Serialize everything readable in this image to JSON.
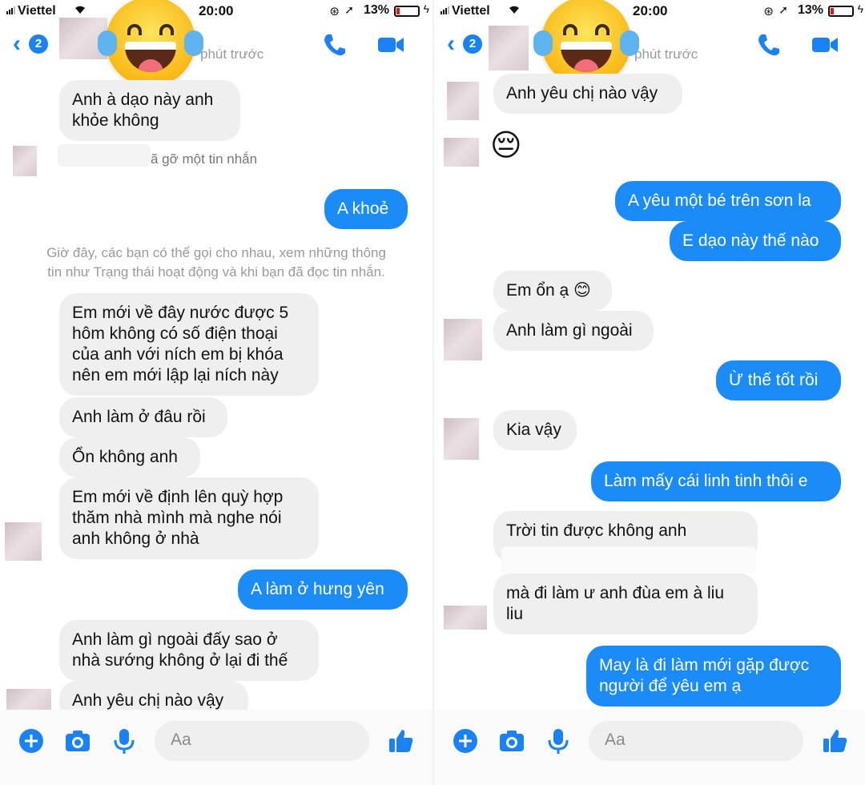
{
  "status_bar": {
    "carrier": "Viettel",
    "time": "20:00",
    "battery": "13%"
  },
  "left": {
    "header": {
      "back_count": "2",
      "active": "phút trước"
    },
    "messages": [
      {
        "dir": "in",
        "text": "Anh à dạo này anh\nkhỏe không"
      },
      {
        "dir": "removed",
        "text": "ã gỡ một tin nhắn"
      },
      {
        "dir": "out",
        "text": "A khoẻ"
      },
      {
        "dir": "notice",
        "text": "Giờ đây, các bạn có thể gọi cho nhau, xem những thông\ntin như Trạng thái hoạt động và khi bạn đã đọc tin nhắn."
      },
      {
        "dir": "in",
        "text": "Em mới về đây nước được 5\nhôm không có số điện thoại\ncủa anh với ních em bị khóa\nnên em mới lập lại ních này"
      },
      {
        "dir": "in",
        "text": "Anh làm ở đâu rồi"
      },
      {
        "dir": "in",
        "text": "Ổn không anh"
      },
      {
        "dir": "in",
        "text": "Em mới về định lên quỳ hợp\nthăm nhà mình mà nghe nói\nanh không ở nhà"
      },
      {
        "dir": "out",
        "text": "A làm ở hưng yên"
      },
      {
        "dir": "in",
        "text": "Anh làm gì ngoài đấy sao ở\nnhà sướng không ở lại đi thế"
      },
      {
        "dir": "in",
        "text": "Anh yêu chị nào vậy"
      }
    ],
    "composer": {
      "placeholder": "Aa"
    }
  },
  "right": {
    "header": {
      "back_count": "2",
      "active": "phút trước"
    },
    "messages": [
      {
        "dir": "in",
        "text": "Anh yêu chị nào vậy"
      },
      {
        "dir": "emoji",
        "text": "😔"
      },
      {
        "dir": "out",
        "text": "A yêu một bé trên sơn la"
      },
      {
        "dir": "out",
        "text": "E dạo này thế nào"
      },
      {
        "dir": "in",
        "text": "Em ổn ạ 😊"
      },
      {
        "dir": "in",
        "text": "Anh làm gì ngoài"
      },
      {
        "dir": "out",
        "text": "Ừ thế tốt rồi"
      },
      {
        "dir": "in",
        "text": "Kia vậy"
      },
      {
        "dir": "out",
        "text": "Làm mấy cái linh tinh thôi e"
      },
      {
        "dir": "in",
        "text": "Trời tin được không anh"
      },
      {
        "dir": "in",
        "text": "mà đi làm ư anh đùa em à liu\nliu"
      },
      {
        "dir": "out",
        "text": "May là đi làm mới gặp được\nngười để yêu em ạ"
      }
    ],
    "composer": {
      "placeholder": "Aa"
    }
  },
  "colors": {
    "accent": "#1b8cf7",
    "bubble_in": "#efefef",
    "meta_text": "#9a9a9a"
  },
  "icons": [
    "back-chevron-icon",
    "phone-icon",
    "video-camera-icon",
    "plus-icon",
    "camera-icon",
    "microphone-icon",
    "thumbs-up-icon",
    "wifi-icon",
    "signal-icon",
    "battery-icon",
    "location-icon",
    "rotation-lock-icon"
  ]
}
